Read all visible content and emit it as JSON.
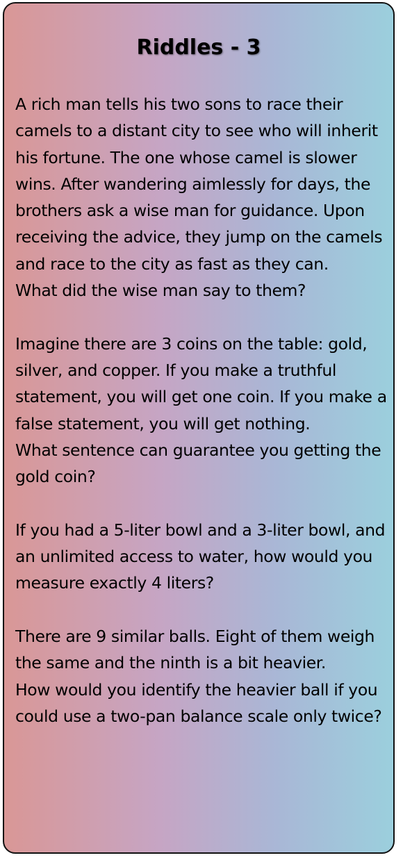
{
  "title": "Riddles - 3",
  "riddles": [
    {
      "lines": [
        "A rich man tells his two sons to race their camels to a distant city to see who will inherit his fortune. The one whose camel is slower wins. After wandering aimlessly for days, the brothers ask a wise man for guidance. Upon receiving the advice, they jump on the camels and race to the city as fast as they can.",
        "What did the wise man say to them?"
      ]
    },
    {
      "lines": [
        "Imagine there are 3 coins on the table: gold, silver, and copper. If you make a truthful statement, you will get one coin. If you make a false statement, you will get nothing.",
        "What sentence can guarantee you getting the gold coin?"
      ]
    },
    {
      "lines": [
        "If you had a 5-liter bowl and a 3-liter bowl, and an unlimited access to water, how would you measure exactly 4 liters?"
      ]
    },
    {
      "lines": [
        "There are 9 similar balls. Eight of them weigh the same and the ninth is a bit heavier.",
        "How would you identify the heavier ball if you could use a two-pan balance scale only twice?"
      ]
    }
  ]
}
